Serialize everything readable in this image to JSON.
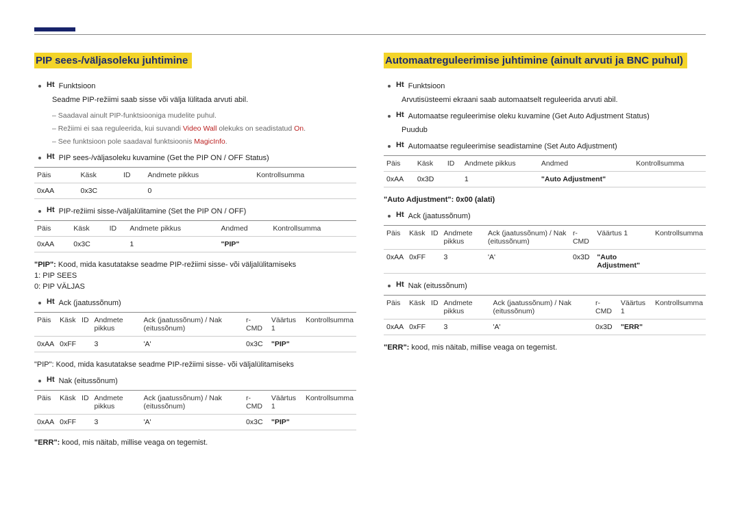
{
  "left": {
    "title": "PIP sees-/väljasoleku juhtimine",
    "func_label": "Ht",
    "func_text": "Funktsioon",
    "func_desc": "Seadme PIP-režiimi saab sisse või välja lülitada arvuti abil.",
    "notes": [
      {
        "text": "Saadaval ainult PIP-funktsiooniga mudelite puhul.",
        "red": false
      },
      {
        "text_pre": "Režiimi ei saa reguleerida, kui suvandi ",
        "strong": "Video Wall",
        "text_post": " olekuks on seadistatud ",
        "trail": "On",
        "trail_suffix": ".",
        "red": true
      },
      {
        "text_pre": "See funktsioon pole saadaval funktsioonis ",
        "strong": "MagicInfo",
        "text_post": ".",
        "red": true
      }
    ],
    "get_label": "Ht",
    "get_text": "PIP sees-/väljasoleku kuvamine (Get the PIP ON / OFF Status)",
    "table1": {
      "headers": [
        "Päis",
        "Käsk",
        "ID",
        "Andmete pikkus",
        "Kontrollsumma"
      ],
      "cells": [
        "0xAA",
        "0x3C",
        "",
        "0",
        ""
      ]
    },
    "set_label": "Ht",
    "set_text": "PIP-režiimi sisse-/väljalülitamine (Set the PIP ON / OFF)",
    "table2": {
      "headers": [
        "Päis",
        "Käsk",
        "ID",
        "Andmete pikkus",
        "Andmed",
        "Kontrollsumma"
      ],
      "cells": [
        "0xAA",
        "0x3C",
        "",
        "1",
        "\"PIP\"",
        ""
      ]
    },
    "pip_key": "\"PIP\":",
    "pip_key_desc": "Kood, mida kasutatakse seadme PIP-režiimi sisse- või väljalülitamiseks",
    "pip_on": "1: PIP SEES",
    "pip_off": "0: PIP VÄLJAS",
    "ack_label": "Ht",
    "ack_text": "Ack (jaatussõnum)",
    "table3": {
      "headers": [
        "Päis",
        "Käsk",
        "ID",
        "Andmete pikkus",
        "Ack (jaatussõnum) / Nak (eitussõnum)",
        "r-CMD",
        "Väärtus 1",
        "Kontrollsumma"
      ],
      "cells": [
        "0xAA",
        "0xFF",
        "",
        "3",
        "'A'",
        "0x3C",
        "\"PIP\"",
        ""
      ]
    },
    "pip_repeat": "\"PIP\": Kood, mida kasutatakse seadme PIP-režiimi sisse- või väljalülitamiseks",
    "nak_label": "Ht",
    "nak_text": "Nak (eitussõnum)",
    "table4": {
      "headers": [
        "Päis",
        "Käsk",
        "ID",
        "Andmete pikkus",
        "Ack (jaatussõnum) / Nak (eitussõnum)",
        "r-CMD",
        "Väärtus 1",
        "Kontrollsumma"
      ],
      "cells": [
        "0xAA",
        "0xFF",
        "",
        "3",
        "'A'",
        "0x3C",
        "\"PIP\"",
        ""
      ]
    },
    "err_label": "\"ERR\":",
    "err_text": "kood, mis näitab, millise veaga on tegemist."
  },
  "right": {
    "title": "Automaatreguleerimise juhtimine (ainult arvuti ja BNC puhul)",
    "func_label": "Ht",
    "func_text": "Funktsioon",
    "func_desc": "Arvutisüsteemi ekraani saab automaatselt reguleerida arvuti abil.",
    "get_label": "Ht",
    "get_text": "Automaatse reguleerimise oleku kuvamine (Get Auto Adjustment Status)",
    "get_none": "Puudub",
    "set_label": "Ht",
    "set_text": "Automaatse reguleerimise seadistamine (Set Auto Adjustment)",
    "table1": {
      "headers": [
        "Päis",
        "Käsk",
        "ID",
        "Andmete pikkus",
        "Andmed",
        "Kontrollsumma"
      ],
      "cells": [
        "0xAA",
        "0x3D",
        "",
        "1",
        "\"Auto Adjustment\"",
        ""
      ]
    },
    "auto_note": "\"Auto Adjustment\": 0x00 (alati)",
    "ack_label": "Ht",
    "ack_text": "Ack (jaatussõnum)",
    "table2": {
      "headers": [
        "Päis",
        "Käsk",
        "ID",
        "Andmete pikkus",
        "Ack (jaatussõnum) / Nak (eitussõnum)",
        "r-CMD",
        "Väärtus 1",
        "Kontrollsumma"
      ],
      "cells": [
        "0xAA",
        "0xFF",
        "",
        "3",
        "'A'",
        "0x3D",
        "\"Auto Adjustment\"",
        ""
      ]
    },
    "nak_label": "Ht",
    "nak_text": "Nak (eitussõnum)",
    "table3": {
      "headers": [
        "Päis",
        "Käsk",
        "ID",
        "Andmete pikkus",
        "Ack (jaatussõnum) / Nak (eitussõnum)",
        "r-CMD",
        "Väärtus 1",
        "Kontrollsumma"
      ],
      "cells": [
        "0xAA",
        "0xFF",
        "",
        "3",
        "'A'",
        "0x3D",
        "\"ERR\"",
        ""
      ]
    },
    "err_label": "\"ERR\":",
    "err_text": "kood, mis näitab, millise veaga on tegemist."
  }
}
